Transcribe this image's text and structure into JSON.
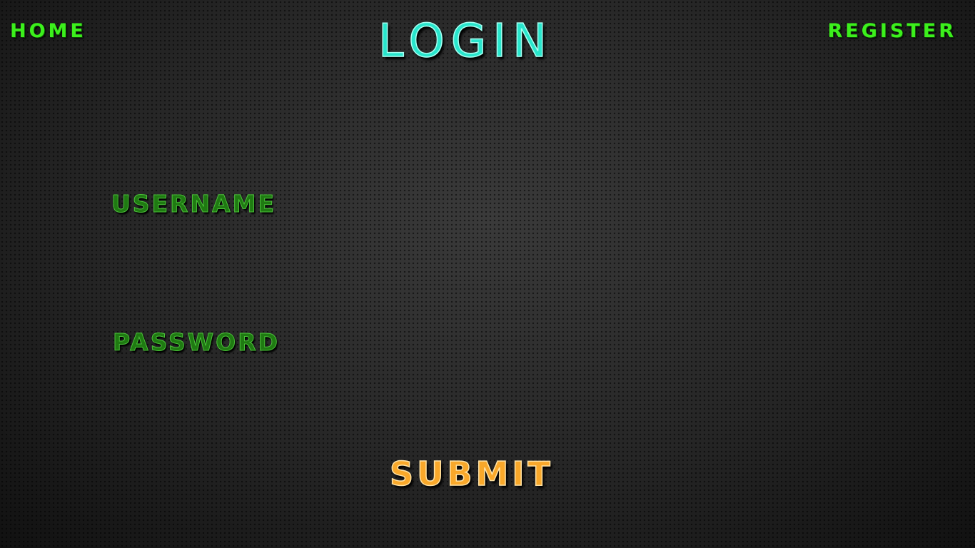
{
  "nav": {
    "home_label": "HOME",
    "register_label": "REGISTER"
  },
  "page": {
    "title": "LOGIN"
  },
  "form": {
    "username_label": "USERNAME",
    "username_value": "",
    "password_label": "PASSWORD",
    "password_value": "",
    "submit_label": "SUBMIT"
  },
  "colors": {
    "nav_green": "#3cf01c",
    "title_cyan": "#28e6cc",
    "label_green": "#1f7a12",
    "submit_orange": "#f9a82a",
    "background": "#2a2a2a"
  }
}
